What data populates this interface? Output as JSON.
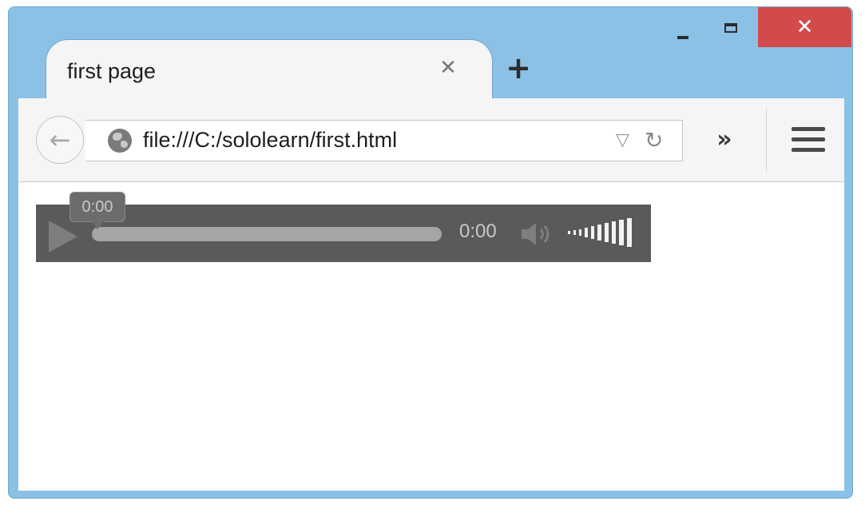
{
  "window": {
    "controls": {
      "minimize_icon": "minimize-icon",
      "maximize_icon": "maximize-icon",
      "close_label": "✕"
    },
    "colors": {
      "frame": "#8cc1e6",
      "close": "#d24a4a",
      "player": "#5a5a5a"
    }
  },
  "tab": {
    "title": "first page",
    "close_label": "✕"
  },
  "new_tab_label": "+",
  "toolbar": {
    "back_label": "←",
    "url": "file:///C:/sololearn/first.html",
    "dropdown_label": "▽",
    "reload_label": "↻",
    "overflow_label": "»"
  },
  "audio": {
    "tooltip_time": "0:00",
    "current_time": "0:00",
    "progress": 0,
    "volume_level": 1.0
  }
}
